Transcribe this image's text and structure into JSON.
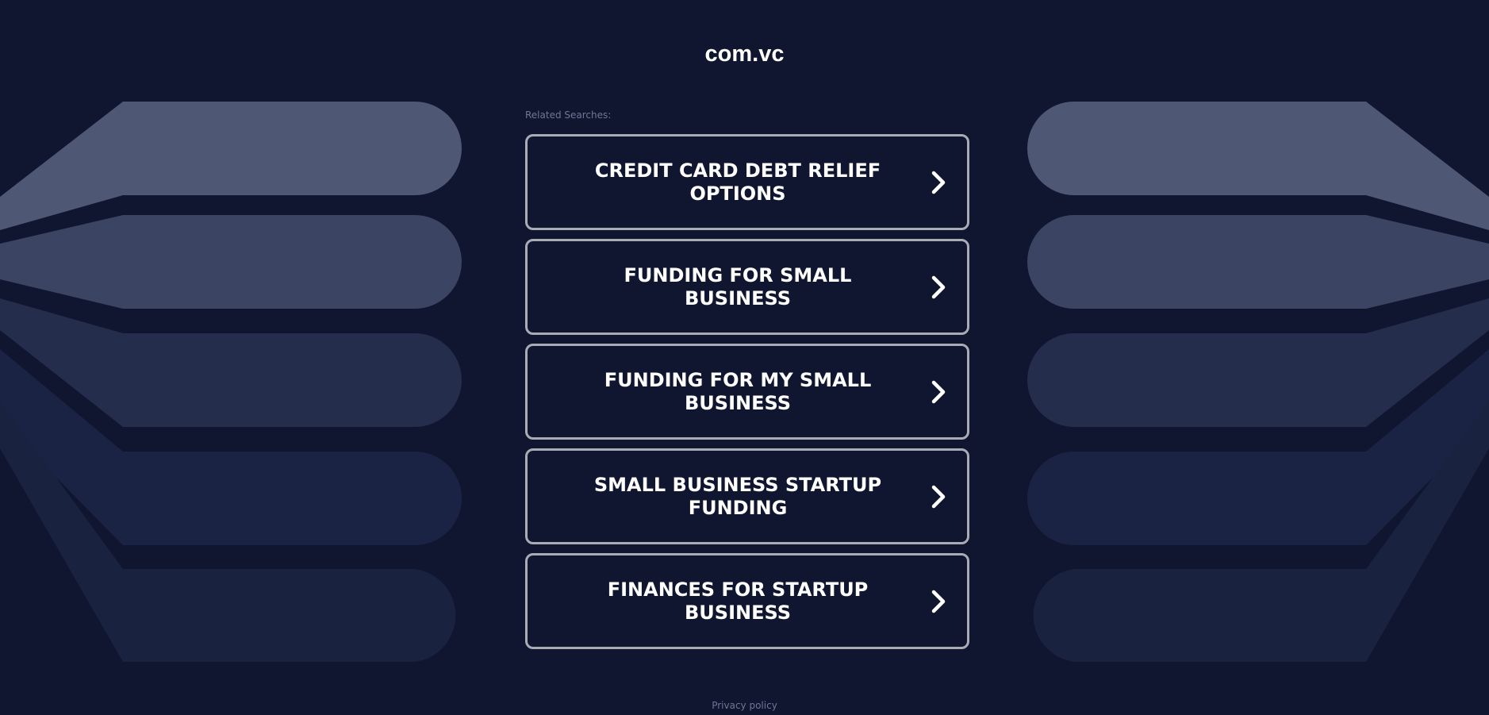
{
  "site": {
    "domain": "com.vc"
  },
  "related": {
    "label": "Related Searches:",
    "items": [
      {
        "label": "CREDIT CARD DEBT RELIEF OPTIONS"
      },
      {
        "label": "FUNDING FOR SMALL BUSINESS"
      },
      {
        "label": "FUNDING FOR MY SMALL BUSINESS"
      },
      {
        "label": "SMALL BUSINESS STARTUP FUNDING"
      },
      {
        "label": "FINANCES FOR STARTUP BUSINESS"
      }
    ],
    "arrow_icon": "chevron-right-icon"
  },
  "footer": {
    "privacy_label": "Privacy policy"
  },
  "colors": {
    "background": "#101630",
    "card_border": "#a9acb4",
    "muted_text": "#6f7796",
    "stripe_1": "#4e5773",
    "stripe_2": "#3b4462",
    "stripe_3": "#252d4d",
    "stripe_4": "#1b2344",
    "stripe_5": "#19223f"
  }
}
